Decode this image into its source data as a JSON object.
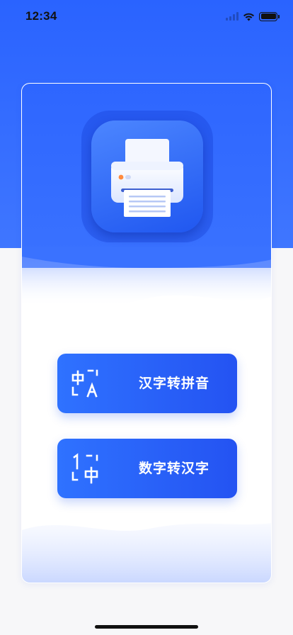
{
  "status_bar": {
    "time": "12:34"
  },
  "menu": [
    {
      "label": "汉字转拼音",
      "icon": "chinese-to-pinyin-icon"
    },
    {
      "label": "数字转汉字",
      "icon": "number-to-chinese-icon"
    }
  ],
  "colors": {
    "primary": "#2e66ff",
    "button_start": "#2f72ff",
    "button_end": "#2453f2",
    "background": "#f7f7f9"
  },
  "icons": {
    "app_logo": "printer-icon"
  }
}
